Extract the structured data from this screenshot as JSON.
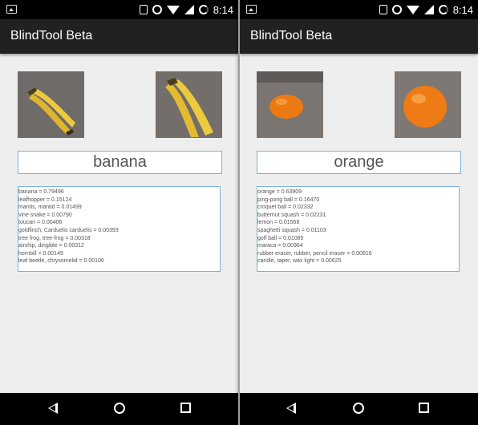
{
  "status_bar": {
    "time": "8:14"
  },
  "app": {
    "title": "BlindTool Beta"
  },
  "left": {
    "label": "banana",
    "results": [
      "banana = 0.79496",
      "leafhopper = 0.15124",
      "mantis, mantid = 0.01499",
      "vine snake = 0.00790",
      "toucan = 0.00406",
      "goldfinch, Carduelis carduelis = 0.00393",
      "tree frog, tree-frog = 0.00318",
      "airship, dirigible = 0.00312",
      "hornbill = 0.00149",
      "leaf beetle, chrysomelid = 0.00106"
    ]
  },
  "right": {
    "label": "orange",
    "results": [
      "orange = 0.63909",
      "ping-pong ball = 0.16470",
      "croquet ball = 0.02332",
      "butternut squash = 0.02231",
      "lemon = 0.01568",
      "spaghetti squash = 0.01103",
      "golf ball = 0.01085",
      "maraca = 0.00964",
      "rubber eraser, rubber, pencil eraser = 0.00816",
      "candle, taper, wax light = 0.00625"
    ]
  },
  "icons": {
    "status": [
      "gallery-icon",
      "vibrate-icon",
      "alarm-icon",
      "wifi-icon",
      "signal-icon",
      "battery-icon"
    ],
    "nav": [
      "back-icon",
      "home-icon",
      "recents-icon"
    ]
  },
  "colors": {
    "app_bar": "#212121",
    "background": "#eeeeee",
    "box_border": "#7fb0d9",
    "banana": "#e8c33a",
    "orange": "#ec7a12"
  }
}
